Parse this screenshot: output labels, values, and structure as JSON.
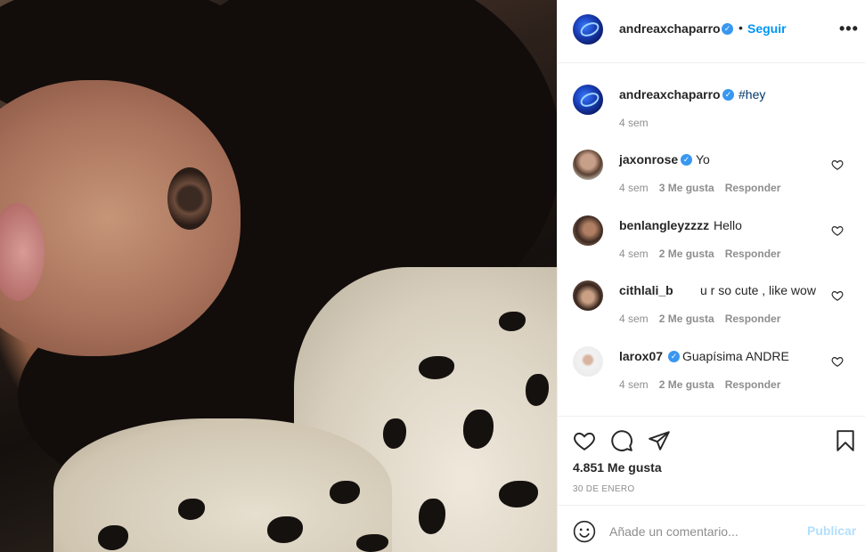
{
  "post": {
    "username": "andreaxchaparro",
    "follow_label": "Seguir",
    "separator": "•",
    "more_label": "•••"
  },
  "caption": {
    "username": "andreaxchaparro",
    "text": "#hey",
    "time": "4 sem"
  },
  "comments": [
    {
      "username": "jaxonrose",
      "verified": true,
      "text": "Yo",
      "time": "4 sem",
      "likes": "3 Me gusta",
      "reply": "Responder"
    },
    {
      "username": "benlangleyzzzz",
      "verified": false,
      "text": "Hello",
      "time": "4 sem",
      "likes": "2 Me gusta",
      "reply": "Responder"
    },
    {
      "username": "cithlali_b",
      "verified": false,
      "text": "u r so cute , like wow",
      "time": "4 sem",
      "likes": "2 Me gusta",
      "reply": "Responder"
    },
    {
      "username": "larox07",
      "verified": true,
      "text": "Guapísima ANDRE",
      "time": "4 sem",
      "likes": "2 Me gusta",
      "reply": "Responder"
    }
  ],
  "stats": {
    "likes": "4.851 Me gusta",
    "date": "30 DE ENERO"
  },
  "composer": {
    "placeholder": "Añade un comentario...",
    "publish_label": "Publicar"
  },
  "icons": {
    "like": "heart-icon",
    "comment": "comment-icon",
    "share": "paper-plane-icon",
    "save": "bookmark-icon",
    "emoji": "smiley-icon",
    "verified": "verified-badge-icon"
  },
  "colors": {
    "link_blue": "#0095f6",
    "verified_blue": "#3897f0",
    "muted": "#8e8e8e",
    "publish_disabled": "#b2dffc"
  }
}
